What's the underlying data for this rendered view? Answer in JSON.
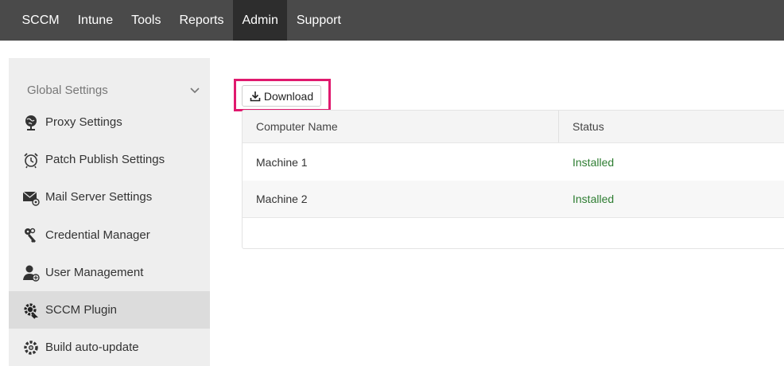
{
  "topnav": {
    "items": [
      {
        "label": "SCCM",
        "active": false
      },
      {
        "label": "Intune",
        "active": false
      },
      {
        "label": "Tools",
        "active": false
      },
      {
        "label": "Reports",
        "active": false
      },
      {
        "label": "Admin",
        "active": true
      },
      {
        "label": "Support",
        "active": false
      }
    ]
  },
  "sidebar": {
    "section_title": "Global Settings",
    "items": [
      {
        "label": "Proxy Settings",
        "icon": "globe-icon"
      },
      {
        "label": "Patch Publish Settings",
        "icon": "alarm-clock-icon"
      },
      {
        "label": "Mail Server Settings",
        "icon": "mail-settings-icon"
      },
      {
        "label": "Credential Manager",
        "icon": "keys-icon"
      },
      {
        "label": "User Management",
        "icon": "user-settings-icon"
      },
      {
        "label": "SCCM Plugin",
        "icon": "plugin-gear-icon",
        "active": true
      },
      {
        "label": "Build auto-update",
        "icon": "gear-update-icon"
      }
    ]
  },
  "main": {
    "download_label": "Download",
    "table": {
      "columns": [
        "Computer Name",
        "Status"
      ],
      "rows": [
        {
          "computer": "Machine 1",
          "status": "Installed"
        },
        {
          "computer": "Machine 2",
          "status": "Installed"
        }
      ]
    }
  },
  "colors": {
    "nav_bg": "#4a4a4a",
    "nav_active": "#2d2d2d",
    "status_ok": "#2e7d32",
    "highlight": "#e0196e"
  }
}
